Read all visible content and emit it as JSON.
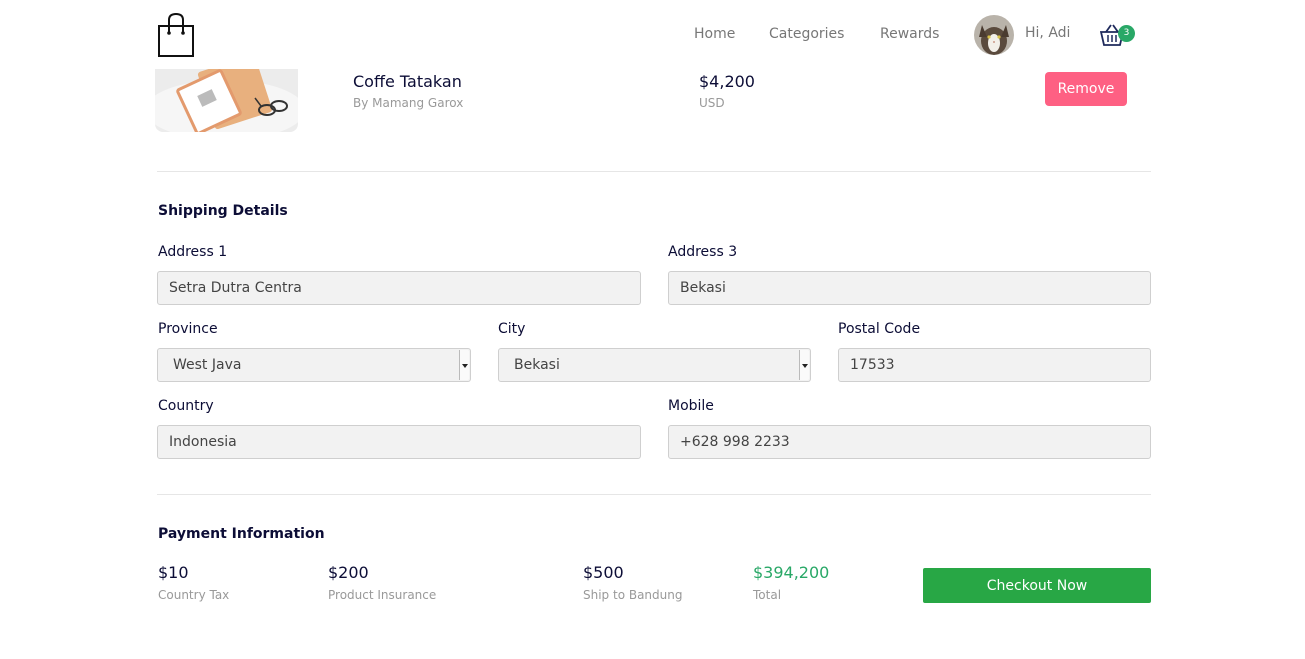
{
  "nav": {
    "links": [
      "Home",
      "Categories",
      "Rewards"
    ],
    "greeting": "Hi, Adi",
    "cart_count": "3"
  },
  "cart_item": {
    "name": "Coffe Tatakan",
    "by": "By Mamang Garox",
    "price": "$4,200",
    "currency": "USD",
    "remove_label": "Remove"
  },
  "shipping": {
    "title": "Shipping Details",
    "address1": {
      "label": "Address 1",
      "value": "Setra Dutra Centra"
    },
    "address3": {
      "label": "Address 3",
      "value": "Bekasi"
    },
    "province": {
      "label": "Province",
      "value": "West Java"
    },
    "city": {
      "label": "City",
      "value": "Bekasi"
    },
    "postal": {
      "label": "Postal Code",
      "value": "17533"
    },
    "country": {
      "label": "Country",
      "value": "Indonesia"
    },
    "mobile": {
      "label": "Mobile",
      "value": "+628 998 2233"
    }
  },
  "payment": {
    "title": "Payment Information",
    "items": [
      {
        "value": "$10",
        "label": "Country Tax"
      },
      {
        "value": "$200",
        "label": "Product Insurance"
      },
      {
        "value": "$500",
        "label": "Ship to Bandung"
      },
      {
        "value": "$394,200",
        "label": "Total"
      }
    ],
    "checkout_label": "Checkout Now"
  },
  "colors": {
    "remove": "#fe6083",
    "checkout": "#28a745",
    "total": "#29a867",
    "badge": "#29a867"
  }
}
